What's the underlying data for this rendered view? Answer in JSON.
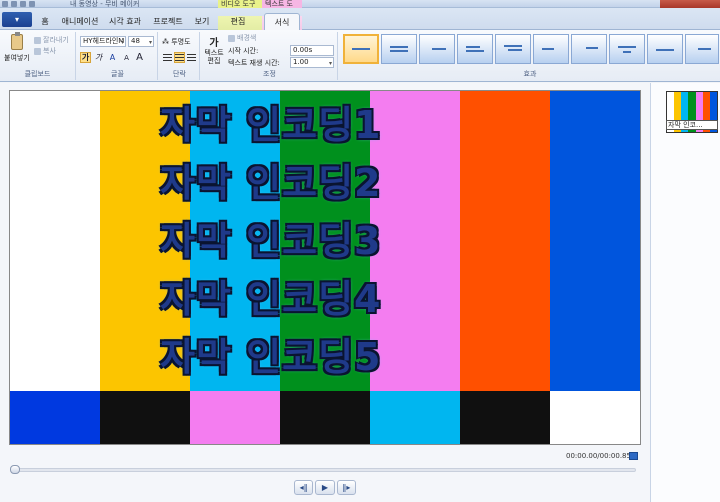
{
  "window": {
    "title": "내 동영상 - 무비 메이커",
    "context_video_tools": "비디오 도구",
    "context_text_tools": "텍스트 도구"
  },
  "tabs": [
    {
      "label": "홈"
    },
    {
      "label": "애니메이션"
    },
    {
      "label": "시각 효과"
    },
    {
      "label": "프로젝트"
    },
    {
      "label": "보기"
    },
    {
      "label": "편집"
    },
    {
      "label": "서식"
    }
  ],
  "ribbon": {
    "clipboard": {
      "paste_label": "붙여넣기",
      "cut_label": "잘라내기",
      "copy_label": "복사",
      "group_label": "클립보드"
    },
    "font": {
      "font_name": "HY헤드라인M",
      "font_size": "48",
      "group_label": "글꼴"
    },
    "paragraph": {
      "transparency_label": "투명도",
      "group_label": "단락"
    },
    "adjust": {
      "text_edit_label": "텍스트\n편집",
      "background_color_label": "배경색",
      "start_time_label": "시작 시간:",
      "start_time_value": "0.00s",
      "duration_label": "텍스트 재생 시간:",
      "duration_value": "1.00",
      "group_label": "조정"
    },
    "effects": {
      "group_label": "효과",
      "count": 10,
      "selected_index": 0
    }
  },
  "preview": {
    "captions": [
      "자막 인코딩1",
      "자막 인코딩2",
      "자막 인코딩3",
      "자막 인코딩4",
      "자막 인코딩5"
    ],
    "bars_top_colors": [
      "#ffffff",
      "#fcc500",
      "#00b6f0",
      "#00901d",
      "#f47df0",
      "#ff5000",
      "#0055dd"
    ],
    "bars_bottom_colors": [
      "#0039e0",
      "#101010",
      "#f47df0",
      "#101010",
      "#00b6f0",
      "#101010",
      "#ffffff"
    ],
    "timecode": "00:00.00/00:00.85"
  },
  "storyboard": {
    "clip_caption": "자막 인코..."
  },
  "colors": {
    "caption_fill": "#1f3a8a",
    "caption_glow": "#5fc3ff",
    "ribbon_accent": "#2f5fb0"
  }
}
